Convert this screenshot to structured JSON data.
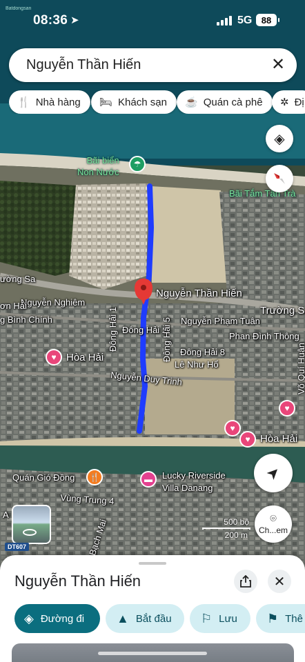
{
  "status_bar": {
    "watermark": "Batdongsan",
    "time": "08:36",
    "network": "5G",
    "battery": "88"
  },
  "search": {
    "query": "Nguyễn Thần Hiến"
  },
  "chips": [
    {
      "icon": "fork-knife-icon",
      "label": "Nhà hàng"
    },
    {
      "icon": "bed-icon",
      "label": "Khách sạn"
    },
    {
      "icon": "coffee-cup-icon",
      "label": "Quán cà phê"
    },
    {
      "icon": "ferris-wheel-icon",
      "label": "Đị"
    }
  ],
  "map": {
    "labels": {
      "beach": "Bãi biển\nNon Nước",
      "beach2": "Bãi Tắm Tân Trà",
      "street_label": "Nguyễn Thần Hiến",
      "truong_sa_left": "ường Sa",
      "truong_sa_right": "Trường Sa",
      "nguyen_nghiem": "Nguyễn Nghiêm",
      "on_hai": "ơn Hải",
      "ng_binh_chinh": "g Bình Chính",
      "dong_hai_1": "Đông Hải 1",
      "dong_hai_2": "Đông Hải 2",
      "dong_hai_5": "Đông Hải 5",
      "nguyen_pham_tuan": "Nguyễn Phạm Tuân",
      "phan_dinh_thong": "Phan Đình Thông",
      "dong_hai_8": "Đông Hải 8",
      "le_nhu_ho": "Lê Như Hổ",
      "hoa_hai_left": "Hòa Hải",
      "nguyen_duy_trinh": "Nguyễn Duy Trinh",
      "vo_qui_huan": "Võ Quí Huân",
      "hoa_hai_right": "Hòa Hải",
      "quan_gio_dong": "Quán Gió Đồng",
      "lucky_riverside": "Lucky Riverside\nVilla Danang",
      "vung_trung_4": "Vùng Trung 4",
      "bach_mai": "Bạch Mai",
      "dt607": "DT607",
      "a_label": "A"
    },
    "scale": {
      "top": "500 bộ",
      "bottom": "200 m"
    },
    "search_area_label": "Ch...em"
  },
  "sheet": {
    "title": "Nguyễn Thần Hiến",
    "actions": [
      {
        "icon": "directions-icon",
        "label": "Đường đi"
      },
      {
        "icon": "navigation-arrow-icon",
        "label": "Bắt đầu"
      },
      {
        "icon": "bookmark-icon",
        "label": "Lưu"
      },
      {
        "icon": "flag-icon",
        "label": "Thê"
      }
    ]
  },
  "colors": {
    "route": "#1f3cff",
    "pin": "#e53935",
    "primary_action": "#0b6e7f",
    "secondary_action": "#d3eef3"
  }
}
